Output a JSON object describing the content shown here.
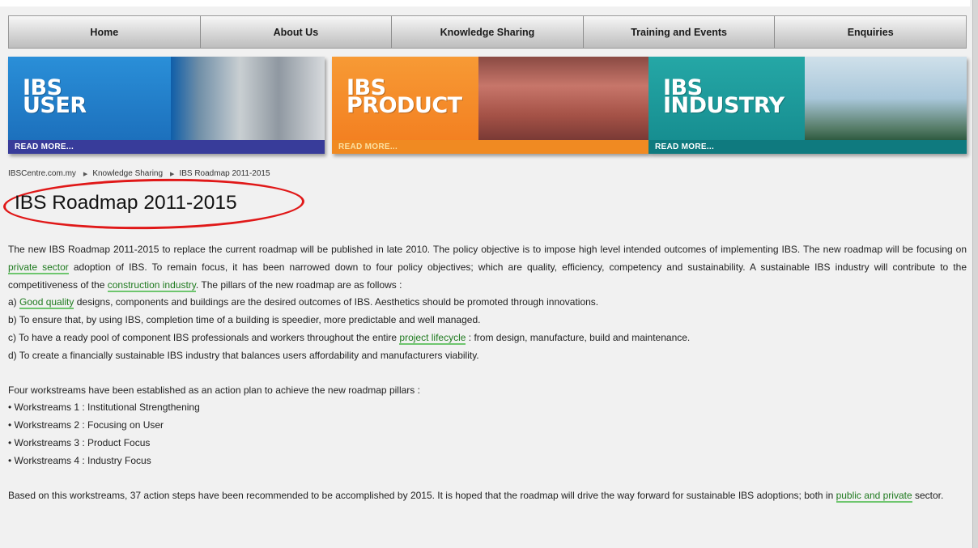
{
  "nav": {
    "items": [
      {
        "label": "Home"
      },
      {
        "label": "About Us"
      },
      {
        "label": "Knowledge Sharing"
      },
      {
        "label": "Training and Events"
      },
      {
        "label": "Enquiries"
      }
    ]
  },
  "banners": [
    {
      "title_line1": "IBS",
      "title_line2": "USER",
      "read_a": "READ ",
      "read_b": "MORE...",
      "color": "#1a6bb8"
    },
    {
      "title_line1": "IBS",
      "title_line2": "PRODUCT",
      "read_a": "READ ",
      "read_b": "MORE...",
      "color": "#f27c1e"
    },
    {
      "title_line1": "IBS",
      "title_line2": "INDUSTRY",
      "read_a": "READ ",
      "read_b": "MORE...",
      "color": "#148a8d"
    }
  ],
  "breadcrumb": {
    "site": "IBSCentre.com.my",
    "section": "Knowledge Sharing",
    "current": "IBS Roadmap 2011-2015"
  },
  "title": "IBS Roadmap 2011-2015",
  "content": {
    "intro": {
      "t1": "The new IBS Roadmap 2011-2015 to replace the current roadmap will be published in late 2010. The policy objective is to impose high level intended outcomes of implementing IBS. The new roadmap will be focusing on ",
      "l1": "private sector",
      "t2": " adoption of IBS. To remain focus, it has been narrowed down to four policy objectives; which are quality, efficiency, competency and sustainability. A sustainable IBS industry will contribute to the competitiveness of the ",
      "l2": "construction industry",
      "t3": ". The pillars of the new roadmap are as follows :"
    },
    "pillar_a": {
      "prefix": "a) ",
      "link": "Good quality",
      "text": " designs, components and buildings are the desired outcomes of IBS. Aesthetics should be promoted through innovations."
    },
    "pillar_b": "b) To ensure that, by using IBS, completion time of a building is speedier, more predictable and well managed.",
    "pillar_c": {
      "prefix": "c) To have a ready pool of component IBS professionals and workers throughout the entire ",
      "link": "project lifecycle",
      "text": " : from design, manufacture, build and maintenance."
    },
    "pillar_d": "d) To create a financially sustainable IBS industry that balances users affordability and manufacturers viability.",
    "workstreams_intro": "Four workstreams have been established as an action plan to achieve the new roadmap pillars :",
    "workstreams": [
      "• Workstreams 1 : Institutional Strengthening",
      "• Workstreams 2 : Focusing on User",
      "• Workstreams 3 : Product Focus",
      "• Workstreams 4 : Industry Focus"
    ],
    "closing": {
      "t1": "Based on this workstreams, 37 action steps have been recommended to be accomplished by 2015. It is hoped that the roadmap will drive the way forward for sustainable IBS adoptions; both in ",
      "l1": "public and private",
      "t2": " sector."
    }
  },
  "colors": {
    "annotation_circle": "#e01818",
    "link": "#1f7a1f",
    "link_underline": "#6ec66e"
  }
}
